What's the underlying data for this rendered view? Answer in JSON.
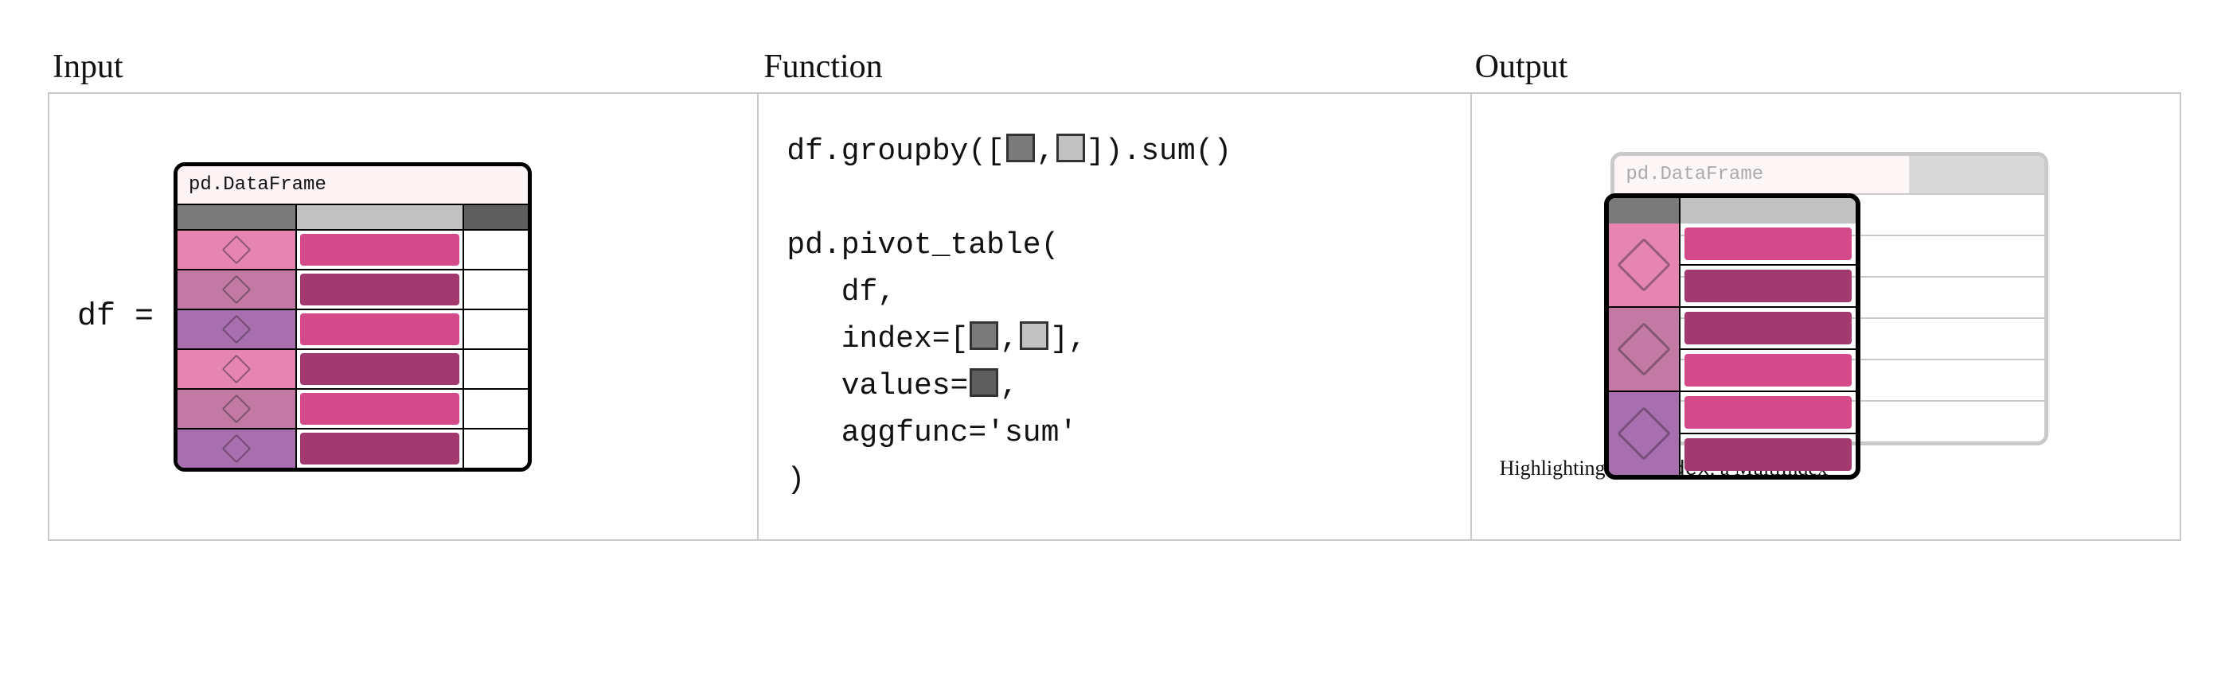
{
  "columns": {
    "input": {
      "title": "Input"
    },
    "function": {
      "title": "Function"
    },
    "output": {
      "title": "Output"
    }
  },
  "input": {
    "assign": "df =",
    "df_label": "pd.DataFrame",
    "header_colors": [
      "#7a7a7a",
      "#c2c2c2",
      "#5e5e5e"
    ],
    "rows": [
      {
        "idx_color": "#e585b0",
        "val_color": "#d34a8a"
      },
      {
        "idx_color": "#c27aa5",
        "val_color": "#a23a6f"
      },
      {
        "idx_color": "#a86fae",
        "val_color": "#d34a8a"
      },
      {
        "idx_color": "#e585b0",
        "val_color": "#a23a6f"
      },
      {
        "idx_color": "#c27aa5",
        "val_color": "#d34a8a"
      },
      {
        "idx_color": "#a86fae",
        "val_color": "#a23a6f"
      }
    ]
  },
  "function": {
    "line1_pre": "df.groupby([",
    "line1_mid": ",",
    "line1_post": "]).sum()",
    "pivot_open": "pd.pivot_table(",
    "pivot_arg1": "   df,",
    "pivot_arg2_pre": "   index=[",
    "pivot_arg2_mid": ",",
    "pivot_arg2_post": "],",
    "pivot_arg3_pre": "   values=",
    "pivot_arg3_post": ",",
    "pivot_arg4": "   aggfunc='sum'",
    "pivot_close": ")"
  },
  "output": {
    "df_label": "pd.DataFrame",
    "ghost_rows": 6,
    "groups": [
      {
        "idx_color": "#e585b0",
        "vals": [
          "#d34a8a",
          "#a23a6f"
        ]
      },
      {
        "idx_color": "#c27aa5",
        "vals": [
          "#a23a6f",
          "#d34a8a"
        ]
      },
      {
        "idx_color": "#a86fae",
        "vals": [
          "#d34a8a",
          "#a23a6f"
        ]
      }
    ],
    "caption_pre": "Highlighting ",
    "caption_code": "df.index",
    "caption_post": ", a MultiIndex"
  }
}
